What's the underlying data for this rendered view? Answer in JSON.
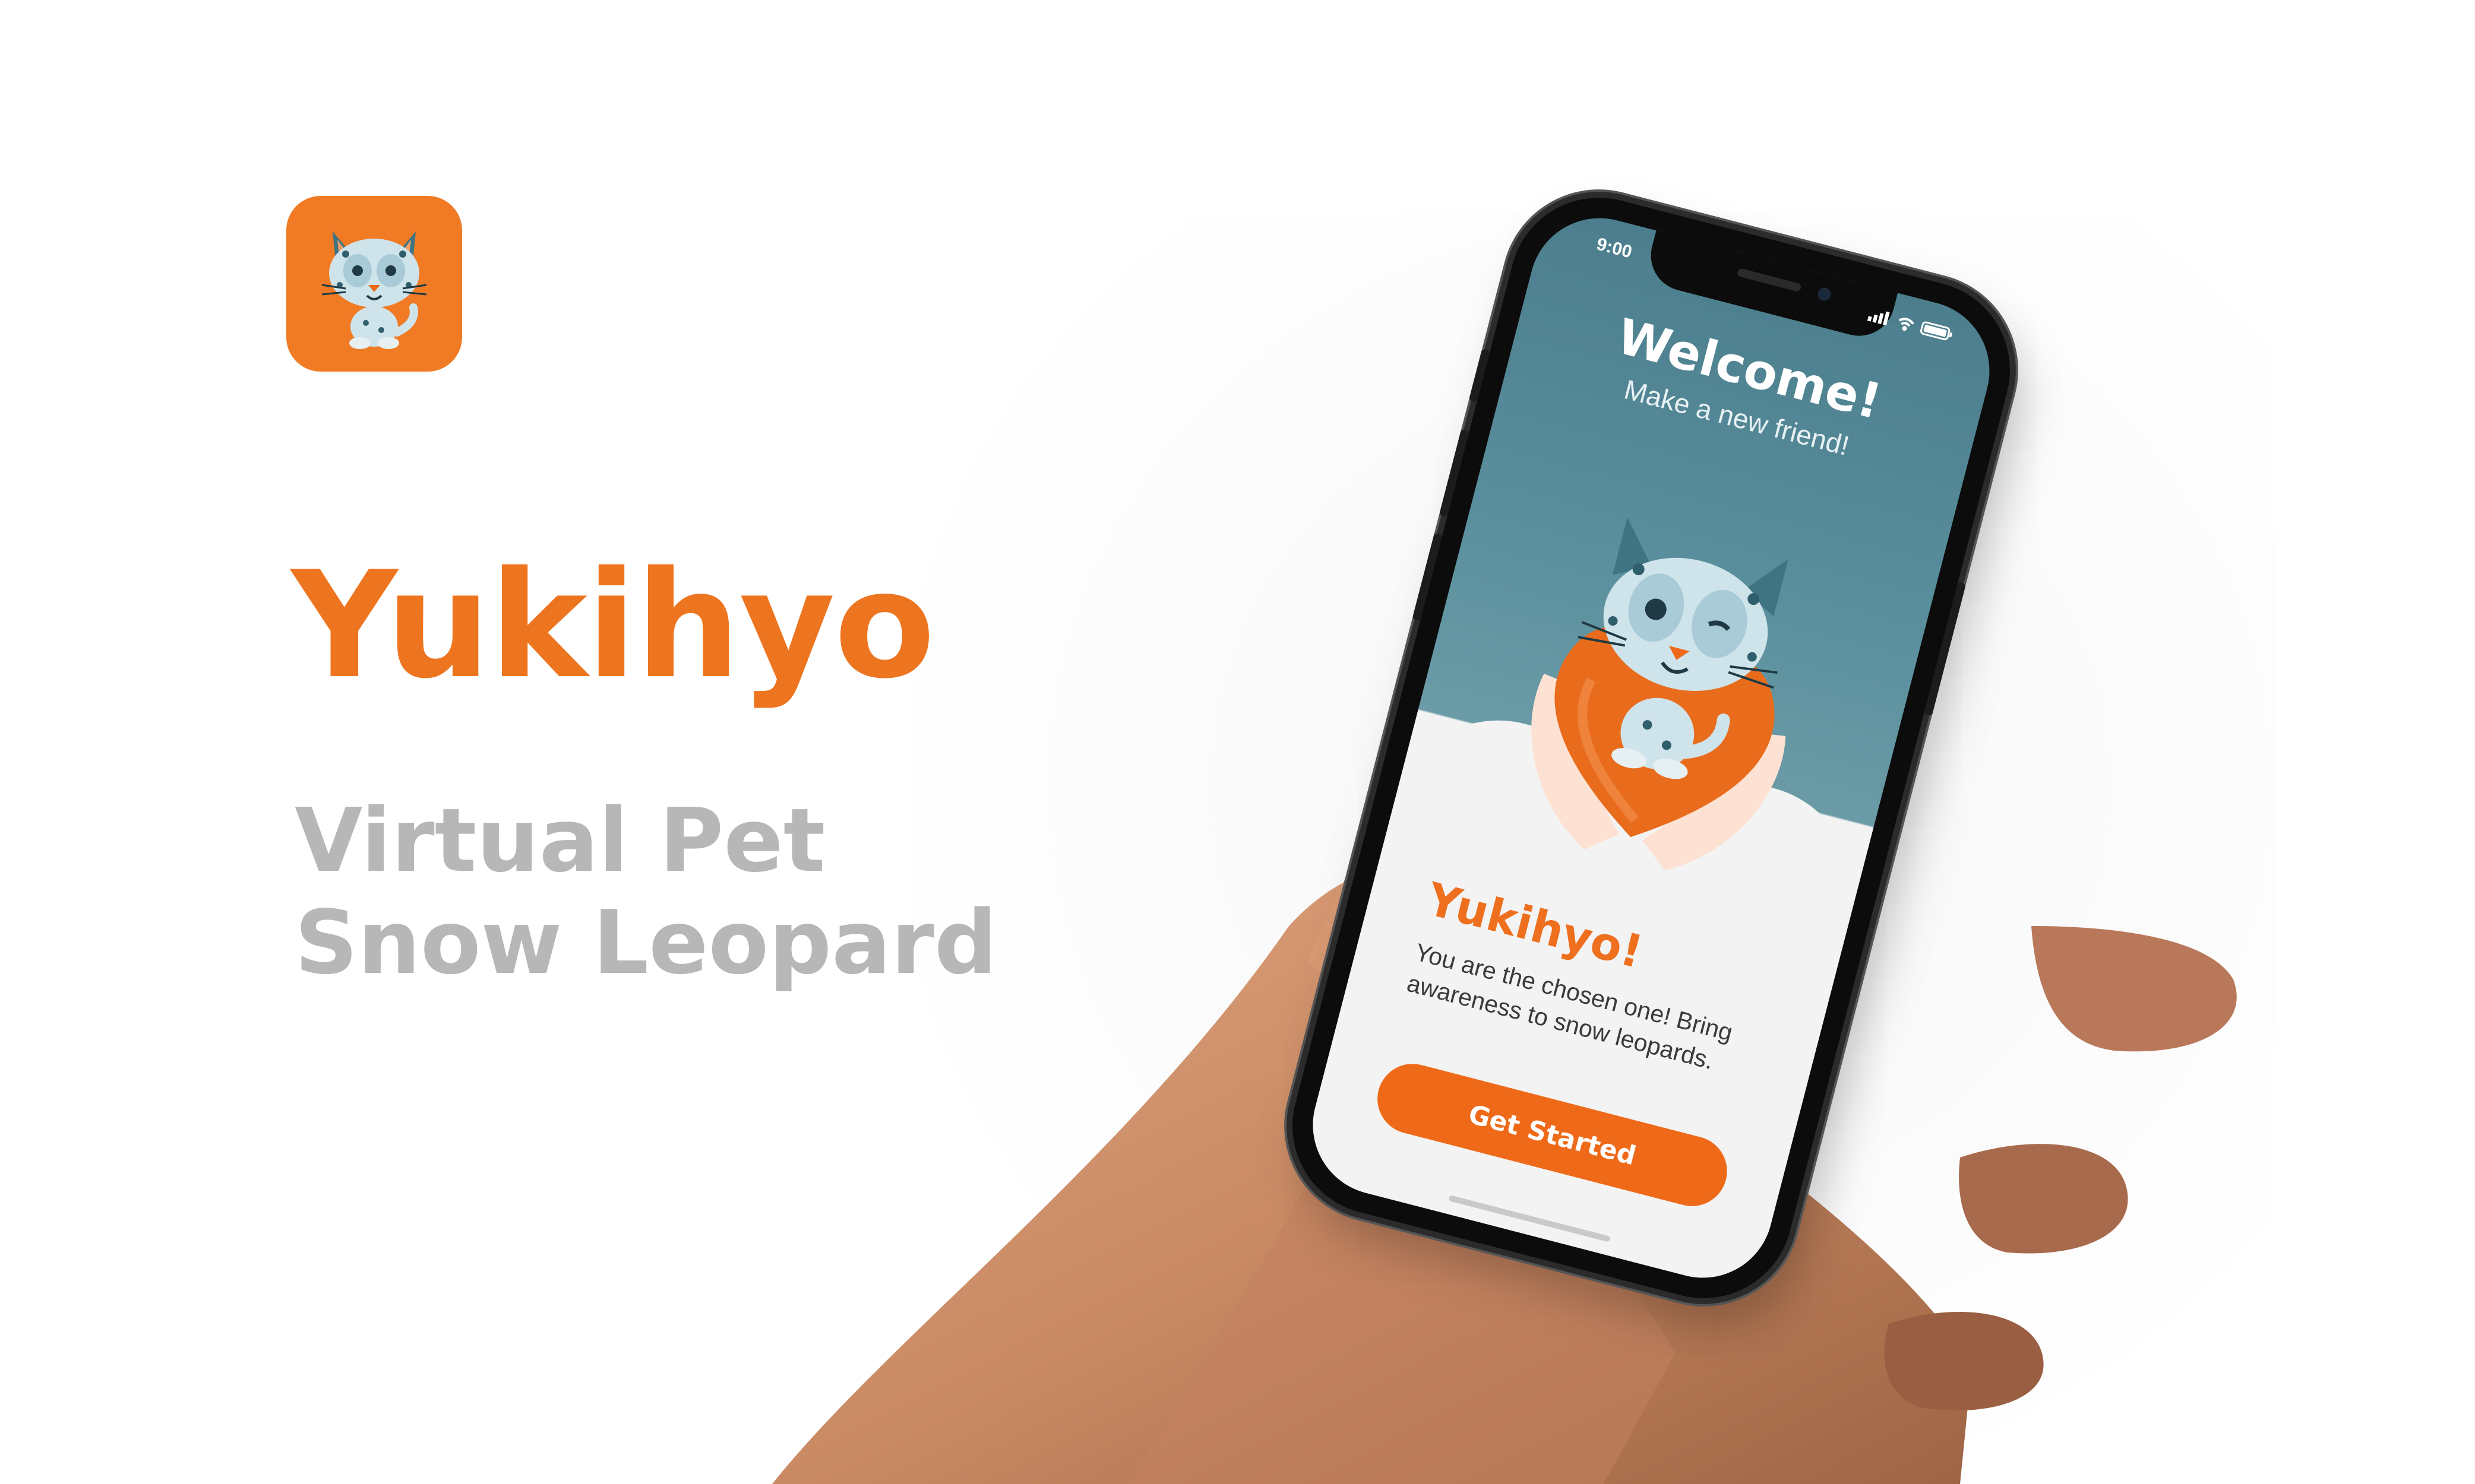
{
  "brand": {
    "app_name": "Yukihyo",
    "tagline": "Virtual Pet Snow Leopard",
    "accent_color": "#ee7520",
    "subtitle_color": "#b7b7b7",
    "icon": "snow-leopard-mascot-icon"
  },
  "phone": {
    "status_bar": {
      "time": "9:00",
      "icons": [
        "signal-icon",
        "wifi-icon",
        "battery-icon"
      ]
    },
    "header": {
      "title": "Welcome!",
      "subtitle": "Make a new friend!"
    },
    "illustration": "snow-leopard-holding-heart",
    "card": {
      "title": "Yukihyo!",
      "body": "You are the chosen one! Bring awareness to snow leopards."
    },
    "cta": {
      "label": "Get Started",
      "color": "#ee6a18"
    },
    "screen_top_color": "#4c7e8d"
  }
}
